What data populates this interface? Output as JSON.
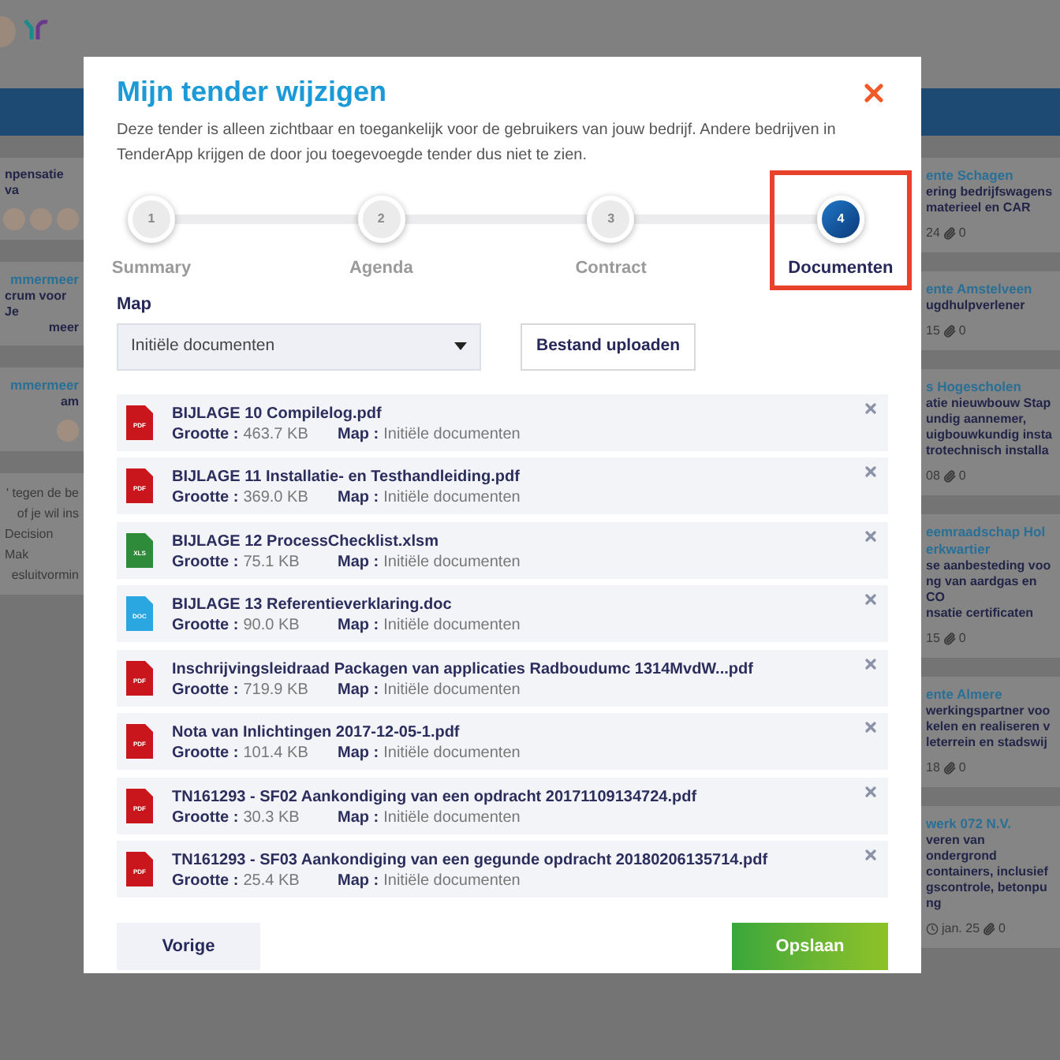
{
  "background": {
    "left_cards": [
      {
        "lines": [
          {
            "kind": "body",
            "text": "npensatie va"
          }
        ],
        "avatars": [
          {
            "kind": "photo"
          },
          {
            "kind": "photo"
          },
          {
            "kind": "photo"
          }
        ]
      },
      {
        "lines": [
          {
            "kind": "title",
            "text": "mmermeer"
          },
          {
            "kind": "body",
            "text": "crum voor Je"
          },
          {
            "kind": "body",
            "text": "meer"
          }
        ]
      },
      {
        "lines": [
          {
            "kind": "title",
            "text": "mmermeer"
          },
          {
            "kind": "body",
            "text": "am"
          }
        ],
        "avatars": [
          {
            "kind": "photo"
          }
        ]
      },
      {
        "lines": [
          {
            "kind": "text",
            "text": "' tegen de be"
          },
          {
            "kind": "text",
            "text": "of je wil ins"
          },
          {
            "kind": "text",
            "text": "Decision Mak"
          },
          {
            "kind": "text",
            "text": "esluitvormin"
          }
        ]
      }
    ],
    "right_cards": [
      {
        "lines": [
          {
            "kind": "title",
            "text": "ente Schagen"
          },
          {
            "kind": "body",
            "text": "ering bedrijfswagens"
          },
          {
            "kind": "body",
            "text": "materieel en CAR"
          }
        ],
        "date": "24",
        "attachments": "0"
      },
      {
        "lines": [
          {
            "kind": "title",
            "text": "ente Amstelveen"
          },
          {
            "kind": "body",
            "text": "ugdhulpverlener"
          }
        ],
        "date": "15",
        "attachments": "0"
      },
      {
        "lines": [
          {
            "kind": "title",
            "text": "s Hogescholen"
          },
          {
            "kind": "body",
            "text": "atie nieuwbouw Stap"
          },
          {
            "kind": "body",
            "text": "undig aannemer,"
          },
          {
            "kind": "body",
            "text": "uigbouwkundig insta"
          },
          {
            "kind": "body",
            "text": "trotechnisch installa"
          }
        ],
        "date": "08",
        "attachments": "0"
      },
      {
        "lines": [
          {
            "kind": "title",
            "text": "eemraadschap Hol"
          },
          {
            "kind": "title",
            "text": "erkwartier"
          },
          {
            "kind": "body",
            "text": "se aanbesteding voo"
          },
          {
            "kind": "body",
            "text": "ng van aardgas en CO"
          },
          {
            "kind": "body",
            "text": "nsatie certificaten"
          }
        ],
        "date": "15",
        "attachments": "0"
      },
      {
        "lines": [
          {
            "kind": "title",
            "text": "ente Almere"
          },
          {
            "kind": "body",
            "text": "werkingspartner voo"
          },
          {
            "kind": "body",
            "text": "kelen en realiseren v"
          },
          {
            "kind": "body",
            "text": "leterrein en stadswij"
          }
        ],
        "date": "18",
        "attachments": "0"
      },
      {
        "lines": [
          {
            "kind": "title",
            "text": "werk 072 N.V."
          },
          {
            "kind": "body",
            "text": "veren van ondergrond"
          },
          {
            "kind": "body",
            "text": "containers, inclusief"
          },
          {
            "kind": "body",
            "text": "gscontrole, betonpu"
          },
          {
            "kind": "body",
            "text": "ng"
          }
        ],
        "date": "jan. 25",
        "attachments": "0",
        "clock": true
      }
    ]
  },
  "modal": {
    "title": "Mijn tender wijzigen",
    "description": "Deze tender is alleen zichtbaar en toegankelijk voor de gebruikers van jouw bedrijf. Andere bedrijven in TenderApp krijgen de door jou toegevoegde tender dus niet te zien.",
    "steps": [
      {
        "number": "1",
        "label": "Summary",
        "selected": false,
        "highlighted": false
      },
      {
        "number": "2",
        "label": "Agenda",
        "selected": false,
        "highlighted": false
      },
      {
        "number": "3",
        "label": "Contract",
        "selected": false,
        "highlighted": false
      },
      {
        "number": "4",
        "label": "Documenten",
        "selected": true,
        "highlighted": true
      }
    ],
    "map_label": "Map",
    "map_select": "Initiële documenten",
    "upload_button": "Bestand uploaden",
    "files": [
      {
        "kind": "pdf",
        "icon_label": "PDF",
        "name": "BIJLAGE 10 Compilelog.pdf",
        "size_label": "Grootte :",
        "size": "463.7 KB",
        "map_label": "Map :",
        "map": "Initiële documenten"
      },
      {
        "kind": "pdf",
        "icon_label": "PDF",
        "name": "BIJLAGE 11 Installatie- en Testhandleiding.pdf",
        "size_label": "Grootte :",
        "size": "369.0 KB",
        "map_label": "Map :",
        "map": "Initiële documenten"
      },
      {
        "kind": "xls",
        "icon_label": "XLS",
        "name": "BIJLAGE 12 ProcessChecklist.xlsm",
        "size_label": "Grootte :",
        "size": "75.1 KB",
        "map_label": "Map :",
        "map": "Initiële documenten"
      },
      {
        "kind": "doc",
        "icon_label": "DOC",
        "name": "BIJLAGE 13 Referentieverklaring.doc",
        "size_label": "Grootte :",
        "size": "90.0 KB",
        "map_label": "Map :",
        "map": "Initiële documenten"
      },
      {
        "kind": "pdf",
        "icon_label": "PDF",
        "name": "Inschrijvingsleidraad Packagen van applicaties Radboudumc 1314MvdW...pdf",
        "size_label": "Grootte :",
        "size": "719.9 KB",
        "map_label": "Map :",
        "map": "Initiële documenten"
      },
      {
        "kind": "pdf",
        "icon_label": "PDF",
        "name": "Nota van Inlichtingen 2017-12-05-1.pdf",
        "size_label": "Grootte :",
        "size": "101.4 KB",
        "map_label": "Map :",
        "map": "Initiële documenten"
      },
      {
        "kind": "pdf",
        "icon_label": "PDF",
        "name": "TN161293 - SF02 Aankondiging van een opdracht 20171109134724.pdf",
        "size_label": "Grootte :",
        "size": "30.3 KB",
        "map_label": "Map :",
        "map": "Initiële documenten"
      },
      {
        "kind": "pdf",
        "icon_label": "PDF",
        "name": "TN161293 - SF03 Aankondiging van een gegunde opdracht 20180206135714.pdf",
        "size_label": "Grootte :",
        "size": "25.4 KB",
        "map_label": "Map :",
        "map": "Initiële documenten"
      }
    ],
    "back_button": "Vorige",
    "save_button": "Opslaan"
  }
}
